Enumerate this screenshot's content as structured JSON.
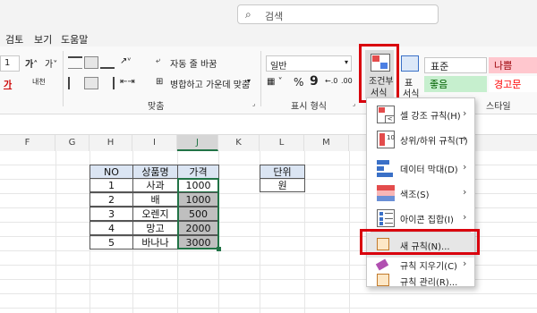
{
  "search": {
    "label": "검색"
  },
  "tabs": [
    "검토",
    "보기",
    "도움말"
  ],
  "ribbon": {
    "font_size_value": "1",
    "wrap_text": "자동 줄 바꿈",
    "merge_center": "병합하고 가운데 맞춤",
    "number_format": "일반",
    "conditional_format_label_1": "조건부",
    "conditional_format_label_2": "서식",
    "table_label_1": "표",
    "table_label_2": "서식",
    "groups": {
      "alignment": "맞춤",
      "number": "표시 형식",
      "styles": "스타일"
    },
    "styles": [
      {
        "label": "표준",
        "bg": "#ffffff",
        "color": "#222222"
      },
      {
        "label": "나쁨",
        "bg": "#ffc7ce",
        "color": "#9c0006"
      },
      {
        "label": "좋음",
        "bg": "#c6efce",
        "color": "#006100"
      },
      {
        "label": "경고문",
        "bg": "#ffffff",
        "color": "#ff0000"
      }
    ]
  },
  "columns": [
    "F",
    "G",
    "H",
    "I",
    "J",
    "K",
    "L",
    "M"
  ],
  "table": {
    "headers": [
      "NO",
      "상품명",
      "가격"
    ],
    "rows": [
      [
        "1",
        "사과",
        "1000"
      ],
      [
        "2",
        "배",
        "1000"
      ],
      [
        "3",
        "오렌지",
        "500"
      ],
      [
        "4",
        "망고",
        "2000"
      ],
      [
        "5",
        "바나나",
        "3000"
      ]
    ]
  },
  "unit_table": {
    "header": "단위",
    "value": "원"
  },
  "menu": {
    "items": [
      {
        "label": "셀 강조 규칙(H)",
        "submenu": true
      },
      {
        "label": "상위/하위 규칙(T)",
        "submenu": true
      },
      {
        "label": "데이터 막대(D)",
        "submenu": true
      },
      {
        "label": "색조(S)",
        "submenu": true
      },
      {
        "label": "아이콘 집합(I)",
        "submenu": true
      },
      {
        "label": "새 규칙(N)...",
        "submenu": false
      },
      {
        "label": "규칙 지우기(C)",
        "submenu": true
      },
      {
        "label": "규칙 관리(R)...",
        "submenu": false
      }
    ]
  },
  "colors": {
    "highlight": "#d9000d",
    "excel_green": "#217346",
    "header_fill": "#dbe5f3",
    "shaded_fill": "#bfbfbf"
  }
}
